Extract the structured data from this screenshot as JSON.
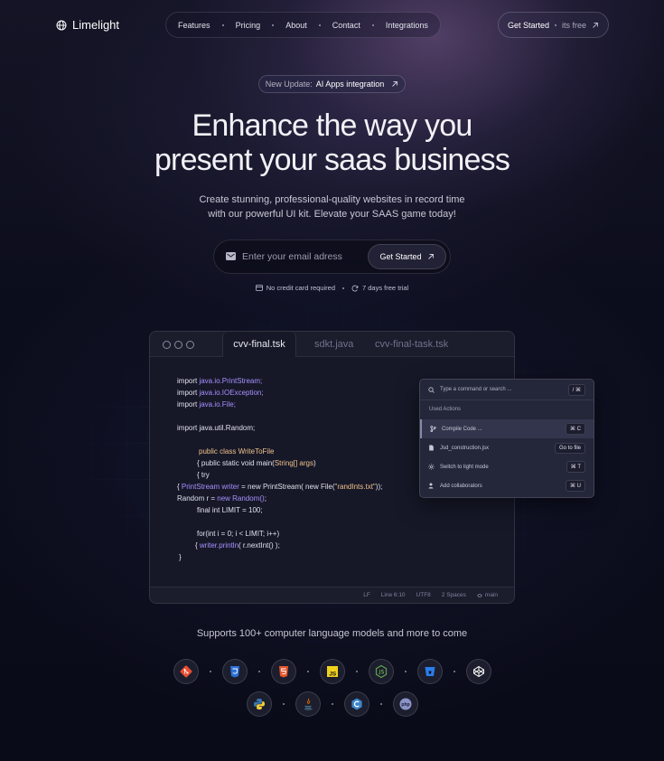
{
  "header": {
    "logo_text": "Limelight",
    "nav": [
      "Features",
      "Pricing",
      "About",
      "Contact",
      "Integrations"
    ],
    "cta_label": "Get Started",
    "cta_sub": "its free"
  },
  "hero": {
    "badge_prefix": "New Update:",
    "badge_text": "AI Apps integration",
    "headline_line1": "Enhance the way you",
    "headline_line2": "present your saas business",
    "sub_line1": "Create stunning, professional-quality websites in record time",
    "sub_line2": "with our powerful UI kit. Elevate your SAAS game today!",
    "email_placeholder": "Enter your email adress",
    "email_button": "Get Started",
    "feature1": "No credit card required",
    "feature2": "7 days free trial"
  },
  "editor": {
    "tabs": [
      "cvv-final.tsk",
      "sdkt.java",
      "cvv-final-task.tsk"
    ],
    "code": {
      "l1a": "import ",
      "l1b": "java.io.PrintStream;",
      "l2a": "import ",
      "l2b": "java.io.IOException;",
      "l3a": "import ",
      "l3b": "java.io.File;",
      "l4": "import java.util.Random;",
      "l5a": "public class ",
      "l5b": "WriteToFile",
      "l6a": "{ public static void main(",
      "l6b": "String[] args",
      "l6c": ")",
      "l7": "{ try",
      "l8a": "{ ",
      "l8b": "PrintStream writer",
      "l8c": " = new PrintStream( new File(",
      "l8d": "\"randInts.txt\"",
      "l8e": "));",
      "l9a": "Random r = ",
      "l9b": "new Random()",
      "l9c": ";",
      "l10": "final int LIMIT = 100;",
      "l11": "for(int i = 0; i < LIMIT; i++)",
      "l12a": "{ ",
      "l12b": "writer.println",
      "l12c": "( r.nextInt() );",
      "l13": "}"
    },
    "status": [
      "LF",
      "Line 6:10",
      "UTF8",
      "2 Spaces",
      "main"
    ]
  },
  "palette": {
    "search_placeholder": "Type a command or search ...",
    "search_shortcut": "/ ⌘",
    "section": "Used Actions",
    "items": [
      {
        "label": "Compile Code ...",
        "shortcut": "⌘ C"
      },
      {
        "label": "Jsd_construction.jsx",
        "shortcut": "Go to file"
      },
      {
        "label": "Switch to light mode",
        "shortcut": "⌘ T"
      },
      {
        "label": "Add collaborators",
        "shortcut": "⌘ U"
      }
    ]
  },
  "supports": "Supports 100+ computer language models and more to come",
  "tech_icons": {
    "row1": [
      "git-icon",
      "css3-icon",
      "html5-icon",
      "javascript-icon",
      "nodejs-icon",
      "bitbucket-icon",
      "codepen-icon"
    ],
    "row2": [
      "python-icon",
      "java-icon",
      "c-plus-plus-icon",
      "php-icon"
    ],
    "js_text": "JS",
    "php_text": "php"
  }
}
